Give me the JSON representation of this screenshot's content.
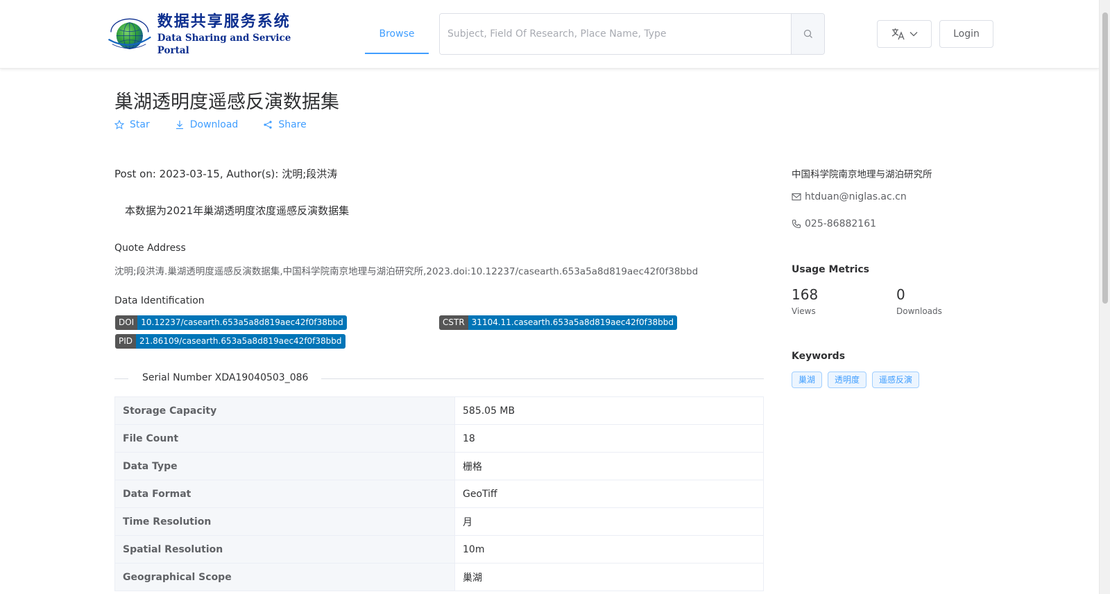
{
  "header": {
    "logo_cn": "数据共享服务系统",
    "logo_en": "Data Sharing and Service Portal",
    "nav_browse": "Browse",
    "search_placeholder": "Subject, Field Of Research, Place Name, Type",
    "login": "Login"
  },
  "dataset": {
    "title": "巢湖透明度遥感反演数据集",
    "actions": {
      "star": "Star",
      "download": "Download",
      "share": "Share"
    },
    "post_line": "Post on: 2023-03-15, Author(s): 沈明;段洪涛",
    "description": "本数据为2021年巢湖透明度浓度遥感反演数据集",
    "quote_heading": "Quote Address",
    "quote_text": "沈明;段洪涛.巢湖透明度遥感反演数据集,中国科学院南京地理与湖泊研究所,2023.doi:10.12237/casearth.653a5a8d819aec42f0f38bbd",
    "ident_heading": "Data Identification",
    "identifiers": {
      "doi_key": "DOI",
      "doi_val": "10.12237/casearth.653a5a8d819aec42f0f38bbd",
      "cstr_key": "CSTR",
      "cstr_val": "31104.11.casearth.653a5a8d819aec42f0f38bbd",
      "pid_key": "PID",
      "pid_val": "21.86109/casearth.653a5a8d819aec42f0f38bbd"
    },
    "serial": "Serial Number XDA19040503_086",
    "table": [
      {
        "k": "Storage Capacity",
        "v": "585.05 MB"
      },
      {
        "k": "File Count",
        "v": "18"
      },
      {
        "k": "Data Type",
        "v": "栅格"
      },
      {
        "k": "Data Format",
        "v": "GeoTiff"
      },
      {
        "k": "Time Resolution",
        "v": "月"
      },
      {
        "k": "Spatial Resolution",
        "v": "10m"
      },
      {
        "k": "Geographical Scope",
        "v": "巢湖"
      }
    ]
  },
  "sidebar": {
    "org": "中国科学院南京地理与湖泊研究所",
    "email": "htduan@niglas.ac.cn",
    "phone": "025-86882161",
    "usage_heading": "Usage Metrics",
    "views_count": "168",
    "views_label": "Views",
    "downloads_count": "0",
    "downloads_label": "Downloads",
    "keywords_heading": "Keywords",
    "keywords": [
      "巢湖",
      "透明度",
      "遥感反演"
    ]
  },
  "colors": {
    "accent": "#409eff",
    "badge_key": "#555555",
    "badge_value": "#0075b7",
    "brand_blue": "#0d2f8f"
  }
}
